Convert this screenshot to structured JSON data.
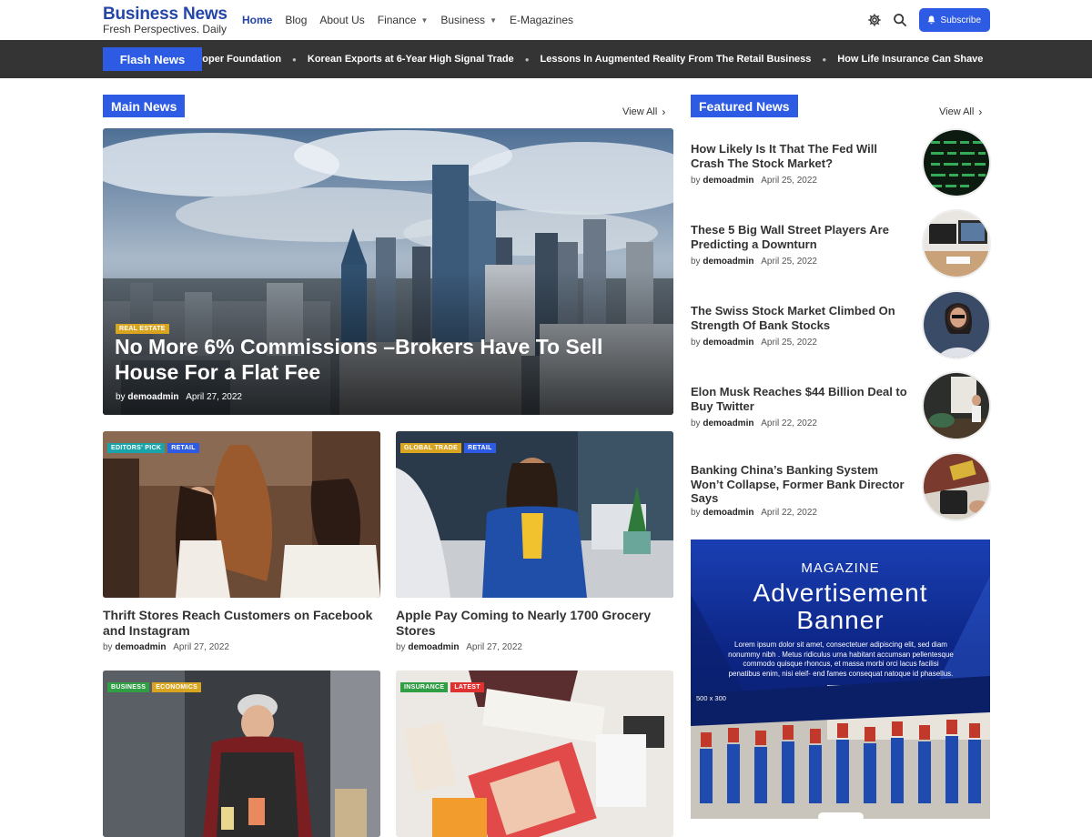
{
  "brand": {
    "title": "Business News",
    "tagline": "Fresh Perspectives. Daily"
  },
  "nav": [
    {
      "label": "Home",
      "active": true,
      "dropdown": false
    },
    {
      "label": "Blog",
      "active": false,
      "dropdown": false
    },
    {
      "label": "About Us",
      "active": false,
      "dropdown": false
    },
    {
      "label": "Finance",
      "active": false,
      "dropdown": true
    },
    {
      "label": "Business",
      "active": false,
      "dropdown": true
    },
    {
      "label": "E-Magazines",
      "active": false,
      "dropdown": false
    }
  ],
  "header": {
    "subscribe_label": "Subscribe",
    "icons": [
      "gear-icon",
      "search-icon",
      "bell-icon"
    ]
  },
  "ticker": {
    "label": "Flash News",
    "items": [
      "roper Foundation",
      "Korean Exports at 6-Year High Signal Trade",
      "Lessons In Augmented Reality From The Retail Business",
      "How Life Insurance Can Shave"
    ]
  },
  "main": {
    "heading": "Main News",
    "view_all": "View All",
    "hero": {
      "tag": "REAL ESTATE",
      "title": "No More 6% Commissions –Brokers Have To Sell House For a Flat Fee",
      "by": "by",
      "author": "demoadmin",
      "date": "April 27, 2022"
    },
    "cards": [
      {
        "tags": [
          "EDITORS' PICK",
          "RETAIL"
        ],
        "title": "Thrift Stores Reach Customers on Facebook and Instagram",
        "by": "by",
        "author": "demoadmin",
        "date": "April 27, 2022"
      },
      {
        "tags": [
          "GLOBAL TRADE",
          "RETAIL"
        ],
        "title": "Apple Pay Coming to Nearly 1700 Grocery Stores",
        "by": "by",
        "author": "demoadmin",
        "date": "April 27, 2022"
      },
      {
        "tags": [
          "BUSINESS",
          "ECONOMICS"
        ],
        "title": "",
        "by": "",
        "author": "",
        "date": ""
      },
      {
        "tags": [
          "INSURANCE",
          "LATEST"
        ],
        "title": "",
        "by": "",
        "author": "",
        "date": ""
      }
    ]
  },
  "featured": {
    "heading": "Featured News",
    "view_all": "View All",
    "items": [
      {
        "title": "How Likely Is It That The Fed Will Crash The Stock Market?",
        "by": "by",
        "author": "demoadmin",
        "date": "April 25, 2022"
      },
      {
        "title": "These 5 Big Wall Street Players Are Predicting a Downturn",
        "by": "by",
        "author": "demoadmin",
        "date": "April 25, 2022"
      },
      {
        "title": "The Swiss Stock Market Climbed On Strength Of Bank Stocks",
        "by": "by",
        "author": "demoadmin",
        "date": "April 25, 2022"
      },
      {
        "title": "Elon Musk Reaches $44 Billion Deal to Buy Twitter",
        "by": "by",
        "author": "demoadmin",
        "date": "April 22, 2022"
      },
      {
        "title": "Banking China’s Banking System Won’t Collapse, Former Bank Director Says",
        "by": "by",
        "author": "demoadmin",
        "date": "April 22, 2022"
      }
    ]
  },
  "ad": {
    "subtitle": "MAGAZINE",
    "title_line1": "Advertisement",
    "title_line2": "Banner",
    "body": "Lorem ipsum dolor sit amet, consectetuer adipiscing elit, sed diam nonummy nibh . Metus ridiculus urna habitant accumsan pellentesque commodo quisque rhoncus, et massa morbi orci lacus facilisi penatibus enim, nisi eleif- end fames consequat natoque id phasellus.",
    "size": "500 x 300"
  },
  "colors": {
    "brand_blue": "#2446a8",
    "accent_blue": "#2d5be3",
    "ticker_bg": "#343434",
    "tag_gold": "#d9a521",
    "tag_teal": "#1aa3a8",
    "tag_blue": "#2d5be3",
    "tag_green": "#2f9e44",
    "tag_red": "#e03131"
  }
}
